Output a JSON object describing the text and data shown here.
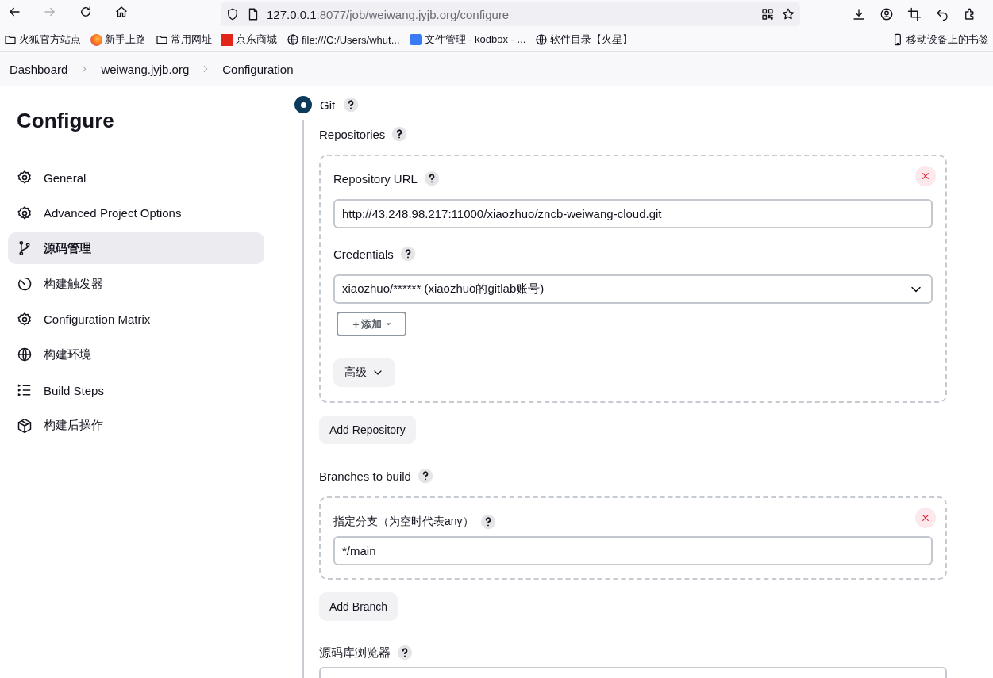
{
  "browser": {
    "back_disabled": false,
    "forward_disabled": true,
    "url_host": "127.0.0.1",
    "url_path": ":8077/job/weiwang.jyjb.org/configure"
  },
  "bookmarks": [
    {
      "label": "火狐官方站点",
      "kind": "folder"
    },
    {
      "label": "新手上路",
      "kind": "firefox"
    },
    {
      "label": "常用网址",
      "kind": "folder"
    },
    {
      "label": "京东商城",
      "kind": "jd"
    },
    {
      "label": "file:///C:/Users/whut...",
      "kind": "globe"
    },
    {
      "label": "文件管理 - kodbox - ...",
      "kind": "kodbox"
    },
    {
      "label": "软件目录【火星】",
      "kind": "globe"
    },
    {
      "label": "移动设备上的书签",
      "kind": "device"
    }
  ],
  "breadcrumb": [
    "Dashboard",
    "weiwang.jyjb.org",
    "Configuration"
  ],
  "sidebar": {
    "title": "Configure",
    "items": [
      {
        "label": "General",
        "kind": "gear",
        "selected": false
      },
      {
        "label": "Advanced Project Options",
        "kind": "gear",
        "selected": false
      },
      {
        "label": "源码管理",
        "kind": "branch",
        "selected": true
      },
      {
        "label": "构建触发器",
        "kind": "timer",
        "selected": false
      },
      {
        "label": "Configuration Matrix",
        "kind": "gear",
        "selected": false
      },
      {
        "label": "构建环境",
        "kind": "globe",
        "selected": false
      },
      {
        "label": "Build Steps",
        "kind": "list",
        "selected": false
      },
      {
        "label": "构建后操作",
        "kind": "package",
        "selected": false
      }
    ]
  },
  "scm": {
    "option": {
      "label": "Git",
      "selected": true
    },
    "repositories_label": "Repositories",
    "repositories": [
      {
        "url_label": "Repository URL",
        "url": "http://43.248.98.217:11000/xiaozhuo/zncb-weiwang-cloud.git",
        "credentials_label": "Credentials",
        "credentials": "xiaozhuo/****** (xiaozhuo的gitlab账号)",
        "add_button": "＋添加",
        "advanced_button": "高级"
      }
    ],
    "add_repository": "Add Repository",
    "branches_label": "Branches to build",
    "branches": [
      {
        "label": "指定分支（为空时代表any）",
        "value": "*/main"
      }
    ],
    "add_branch": "Add Branch",
    "repository_browser_label": "源码库浏览器"
  }
}
